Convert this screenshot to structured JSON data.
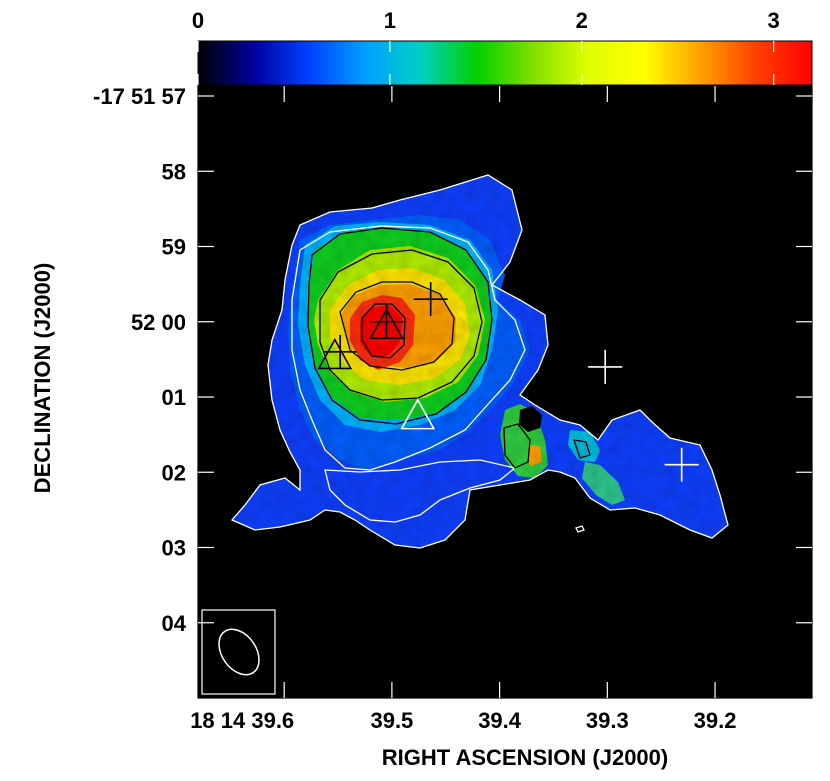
{
  "chart_data": {
    "type": "heatmap",
    "xlabel": "RIGHT ASCENSION (J2000)",
    "ylabel": "DECLINATION (J2000)",
    "colorbar": {
      "ticks": [
        "0",
        "1",
        "2",
        "3"
      ],
      "tick_values": [
        0,
        1,
        2,
        3
      ],
      "range": [
        0,
        3.2
      ],
      "colormap": [
        "#000000",
        "#0000a0",
        "#0040ff",
        "#00a0ff",
        "#00d0c0",
        "#00d000",
        "#80e000",
        "#e0ff00",
        "#ffff00",
        "#ffa000",
        "#ff4000",
        "#ff0000"
      ]
    },
    "x_ticks": {
      "labels": [
        "18 14 39.6",
        "39.5",
        "39.4",
        "39.3",
        "39.2"
      ],
      "values_sec": [
        39.6,
        39.5,
        39.4,
        39.3,
        39.2
      ]
    },
    "y_ticks": {
      "labels": [
        "-17 51 57",
        "58",
        "59",
        "52 00",
        "01",
        "02",
        "03",
        "04"
      ],
      "values_arcsec_offset": [
        57,
        58,
        59,
        60,
        61,
        62,
        63,
        64
      ]
    },
    "x_range_sec": [
      39.68,
      39.11
    ],
    "y_range_arcsec_offset": [
      57,
      65
    ],
    "markers": [
      {
        "symbol": "triangle",
        "color": "#000000",
        "ra_sec": 39.505,
        "dec_offset": 60.05
      },
      {
        "symbol": "triangle",
        "color": "#000000",
        "ra_sec": 39.553,
        "dec_offset": 60.45
      },
      {
        "symbol": "triangle",
        "color": "#ffffff",
        "ra_sec": 39.476,
        "dec_offset": 61.25
      },
      {
        "symbol": "plus",
        "color": "#000000",
        "ra_sec": 39.464,
        "dec_offset": 59.7
      },
      {
        "symbol": "plus",
        "color": "#000000",
        "ra_sec": 39.505,
        "dec_offset": 60.0
      },
      {
        "symbol": "plus",
        "color": "#000000",
        "ra_sec": 39.548,
        "dec_offset": 60.4
      },
      {
        "symbol": "plus",
        "color": "#ffffff",
        "ra_sec": 39.302,
        "dec_offset": 60.6
      },
      {
        "symbol": "plus",
        "color": "#ffffff",
        "ra_sec": 39.231,
        "dec_offset": 61.9
      }
    ],
    "peak_value": 3.1,
    "beam": {
      "shape": "ellipse",
      "color": "#ffffff"
    }
  }
}
